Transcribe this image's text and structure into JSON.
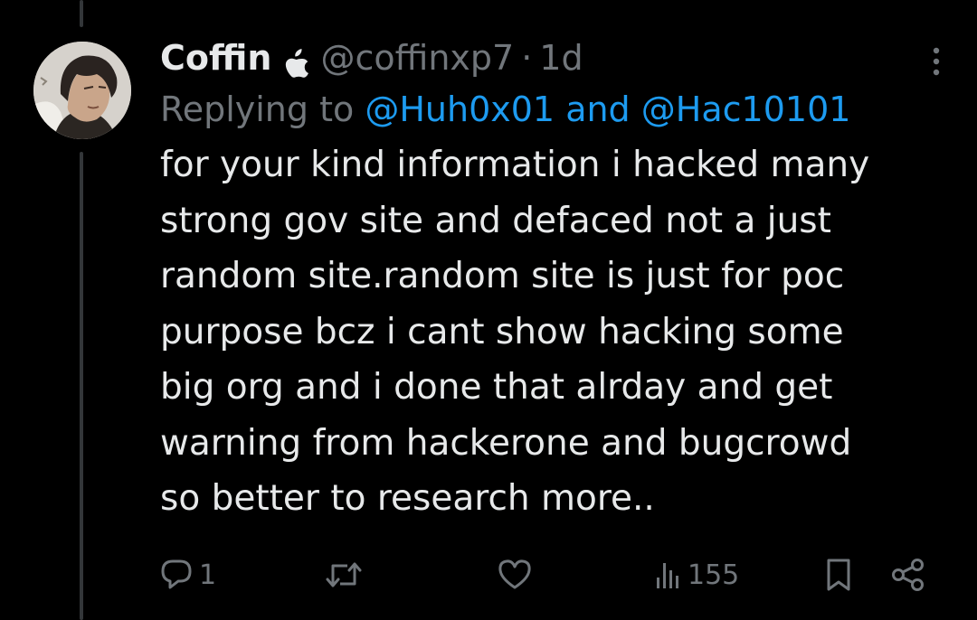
{
  "tweet": {
    "display_name": "Coffin",
    "badge_icon": "apple-icon",
    "handle": "@coffinxp7",
    "separator": "·",
    "time": "1d",
    "replying_prefix": "Replying to",
    "reply_mentions": [
      "@Huh0x01",
      "@Hac10101"
    ],
    "reply_joiner": "and",
    "body_lines": [
      "for your kind information i hacked many",
      "strong gov site and defaced not a just",
      "random site.random site is just for poc",
      "purpose bcz i cant show hacking some",
      "big org and i done that alrday and get",
      "warning from hackerone and bugcrowd",
      "so better to research more.."
    ]
  },
  "actions": {
    "reply": {
      "icon": "reply-icon",
      "count": "1"
    },
    "retweet": {
      "icon": "retweet-icon"
    },
    "like": {
      "icon": "heart-icon"
    },
    "views": {
      "icon": "views-icon",
      "count": "155"
    },
    "bookmark": {
      "icon": "bookmark-icon"
    },
    "share": {
      "icon": "share-icon"
    }
  },
  "colors": {
    "background": "#000000",
    "text_primary": "#e7e9ea",
    "text_secondary": "#71767b",
    "link": "#1d9bf0",
    "thread_line": "#333639"
  }
}
